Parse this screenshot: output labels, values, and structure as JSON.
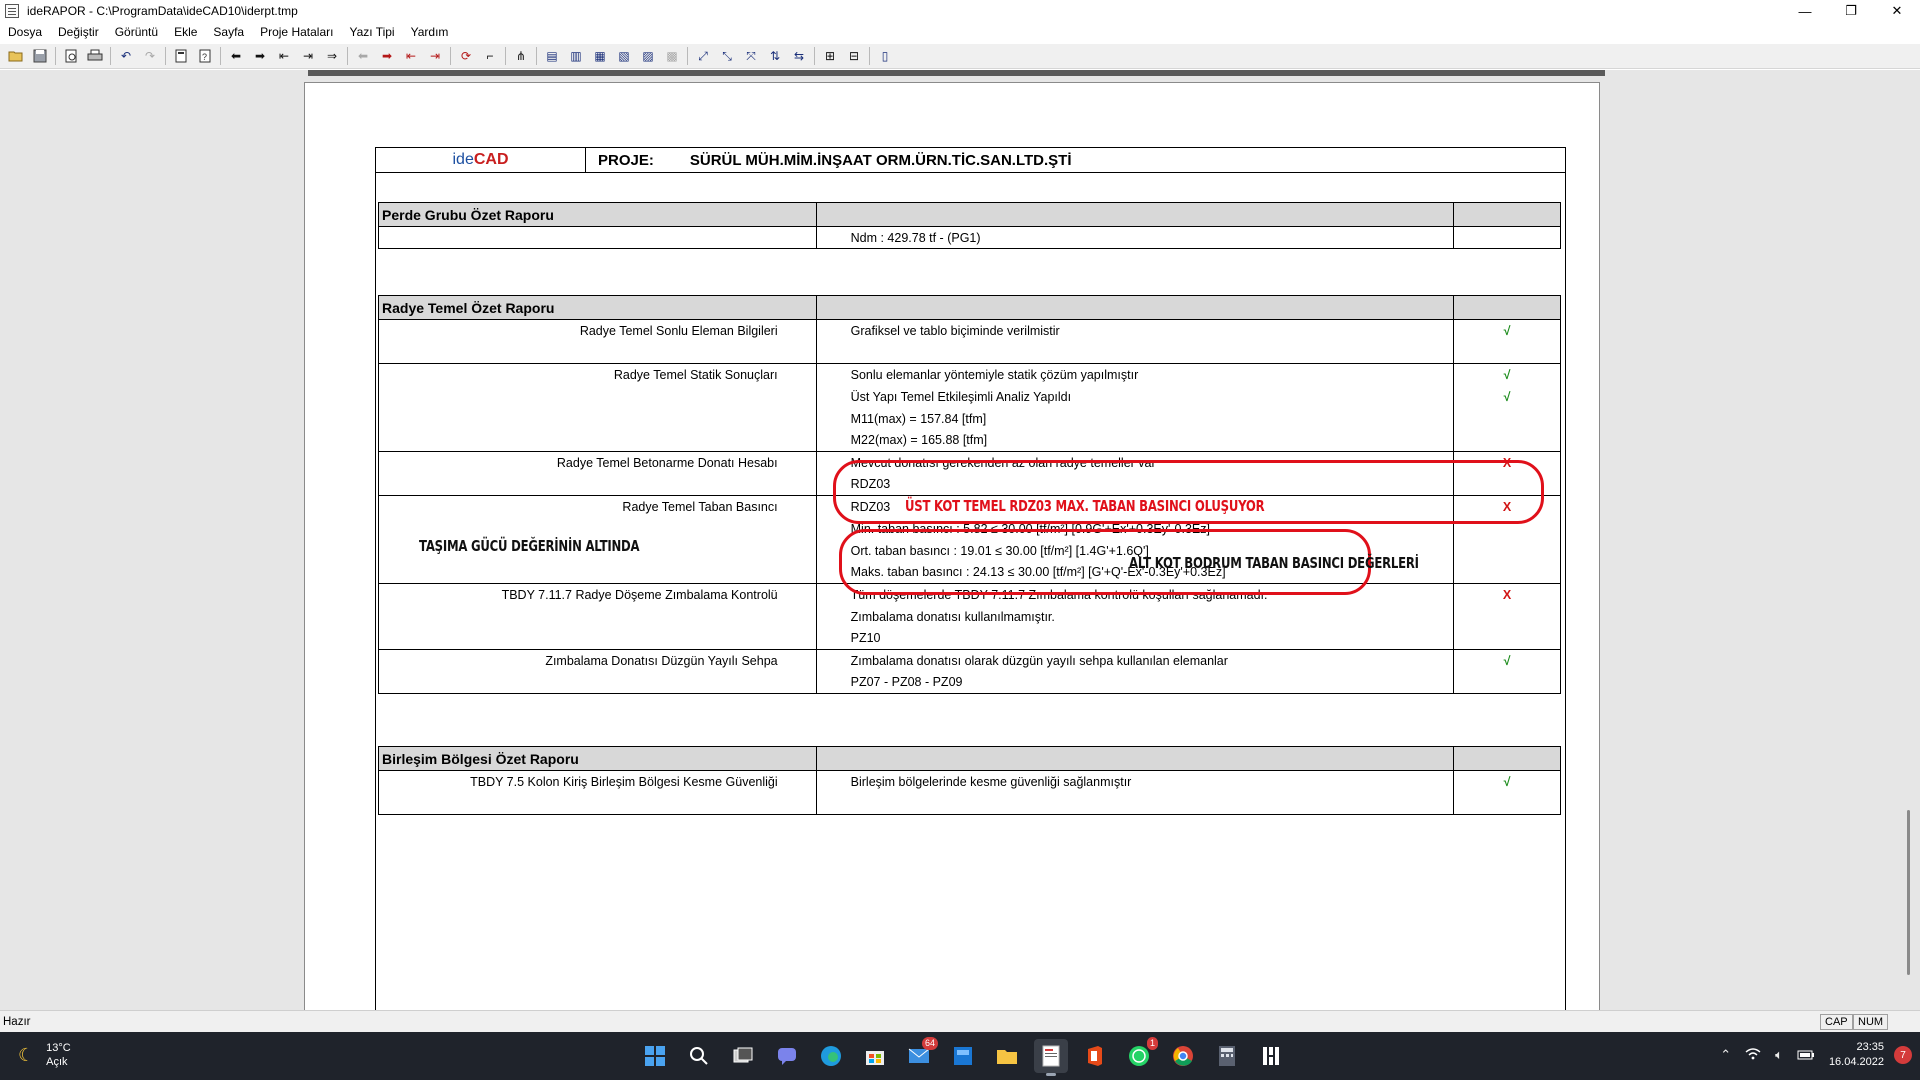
{
  "window": {
    "title": "ideRAPOR - C:\\ProgramData\\ideCAD10\\iderpt.tmp",
    "minimize": "—",
    "maximize": "❐",
    "close": "✕"
  },
  "menu": [
    "Dosya",
    "Değiştir",
    "Görüntü",
    "Ekle",
    "Sayfa",
    "Proje Hataları",
    "Yazı Tipi",
    "Yardım"
  ],
  "document": {
    "logo_ide": "ide",
    "logo_cad": "CAD",
    "project_label": "PROJE:",
    "project_name": "SÜRÜL MÜH.MİM.İNŞAAT ORM.ÜRN.TİC.SAN.LTD.ŞTİ"
  },
  "sections": {
    "perde": {
      "title": "Perde Grubu Özet Raporu",
      "rows": [
        {
          "label": "",
          "value": "Ndm : 429.78 tf - (PG1)",
          "mark": ""
        }
      ]
    },
    "radye": {
      "title": "Radye Temel Özet Raporu",
      "rows": [
        {
          "label": "Radye Temel Sonlu Eleman Bilgileri",
          "value": "Grafiksel ve tablo biçiminde verilmistir",
          "mark": "√"
        },
        {
          "label": "",
          "value": "",
          "mark": ""
        },
        {
          "label": "Radye Temel Statik Sonuçları",
          "value": "Sonlu elemanlar yöntemiyle statik çözüm yapılmıştır",
          "mark": "√"
        },
        {
          "label": "",
          "value": "Üst Yapı Temel Etkileşimli Analiz Yapıldı",
          "mark": "√"
        },
        {
          "label": "",
          "value": "M11(max) = 157.84 [tfm]",
          "mark": ""
        },
        {
          "label": "",
          "value": "M22(max) = 165.88 [tfm]",
          "mark": ""
        },
        {
          "label": "Radye Temel Betonarme Donatı Hesabı",
          "value": "Mevcut donatısı gerekenden az olan radye temeller var",
          "mark": "X"
        },
        {
          "label": "",
          "value": "RDZ03",
          "mark": ""
        },
        {
          "label": "Radye Temel Taban Basıncı",
          "value": "RDZ03",
          "mark": "X"
        },
        {
          "label": "",
          "value": "Min. taban basıncı : 5.82 ≤ 30.00 [tf/m²] [0.9G'+Ex'+0.3Ey'-0.3Ez]",
          "mark": ""
        },
        {
          "label": "",
          "value": "Ort. taban basıncı : 19.01 ≤ 30.00 [tf/m²] [1.4G'+1.6Q']",
          "mark": ""
        },
        {
          "label": "",
          "value": "Maks. taban basıncı : 24.13 ≤ 30.00 [tf/m²] [G'+Q'-Ex'-0.3Ey'+0.3Ez]",
          "mark": ""
        },
        {
          "label": "TBDY 7.11.7 Radye Döşeme Zımbalama Kontrolü",
          "value": "Tüm döşemelerde TBDY 7.11.7 Zımbalama kontrolü koşulları sağlanamadı.",
          "mark": "X"
        },
        {
          "label": "",
          "value": "Zımbalama donatısı kullanılmamıştır.",
          "mark": ""
        },
        {
          "label": "",
          "value": "PZ10",
          "mark": ""
        },
        {
          "label": "Zımbalama Donatısı Düzgün Yayılı Sehpa",
          "value": "Zımbalama donatısı olarak düzgün yayılı sehpa kullanılan elemanlar",
          "mark": "√"
        },
        {
          "label": "",
          "value": "PZ07 - PZ08 - PZ09",
          "mark": ""
        }
      ]
    },
    "birlesim": {
      "title": "Birleşim Bölgesi Özet Raporu",
      "rows": [
        {
          "label": "TBDY 7.5 Kolon Kiriş Birleşim Bölgesi Kesme Güvenliği",
          "value": "Birleşim bölgelerinde kesme güvenliği sağlanmıştır",
          "mark": "√"
        },
        {
          "label": "",
          "value": "",
          "mark": ""
        }
      ]
    }
  },
  "annotations": {
    "ust_kot": "ÜST KOT TEMEL RDZ03 MAX. TABAN BASINCI OLUŞUYOR",
    "tasima": "TAŞIMA GÜCÜ DEĞERİNİN ALTINDA",
    "alt_kot": "ALT KOT BODRUM TABAN BASINCI DEĞERLERİ",
    "color": "#e0101a"
  },
  "status": {
    "ready": "Hazır",
    "cap": "CAP",
    "num": "NUM"
  },
  "taskbar": {
    "temperature": "13°C",
    "condition": "Açık",
    "time": "23:35",
    "date": "16.04.2022",
    "notifications": "7",
    "badge_teams": "64",
    "badge_whatsapp": "1"
  }
}
